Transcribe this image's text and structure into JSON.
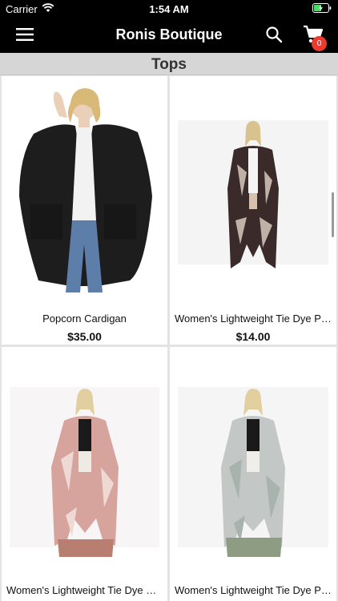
{
  "status_bar": {
    "carrier": "Carrier",
    "time": "1:54 AM"
  },
  "navbar": {
    "title": "Ronis Boutique",
    "cart_count": "0"
  },
  "category": {
    "title": "Tops"
  },
  "products": [
    {
      "name": "Popcorn Cardigan",
      "price": "$35.00"
    },
    {
      "name": "Women's Lightweight Tie Dye Prin...",
      "price": "$14.00"
    },
    {
      "name": "Women's Lightweight Tie Dye Prin...",
      "price": ""
    },
    {
      "name": "Women's Lightweight Tie Dye Prin...",
      "price": ""
    }
  ],
  "colors": {
    "header_bg": "#000000",
    "badge": "#ef3b2f",
    "battery": "#4cd964",
    "category_bar": "#d6d6d6"
  },
  "icons": [
    "wifi-icon",
    "battery-icon",
    "menu-icon",
    "search-icon",
    "cart-icon"
  ]
}
